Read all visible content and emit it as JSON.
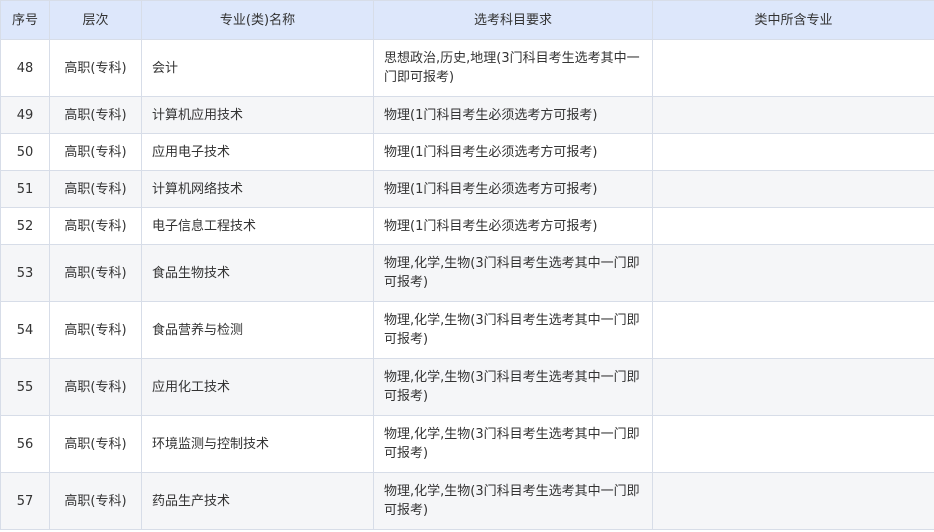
{
  "headers": {
    "seq": "序号",
    "level": "层次",
    "name": "专业(类)名称",
    "requirement": "选考科目要求",
    "sub_majors": "类中所含专业"
  },
  "rows": [
    {
      "seq": "48",
      "level": "高职(专科)",
      "name": "会计",
      "requirement": "思想政治,历史,地理(3门科目考生选考其中一门即可报考)",
      "sub_majors": ""
    },
    {
      "seq": "49",
      "level": "高职(专科)",
      "name": "计算机应用技术",
      "requirement": "物理(1门科目考生必须选考方可报考)",
      "sub_majors": ""
    },
    {
      "seq": "50",
      "level": "高职(专科)",
      "name": "应用电子技术",
      "requirement": "物理(1门科目考生必须选考方可报考)",
      "sub_majors": ""
    },
    {
      "seq": "51",
      "level": "高职(专科)",
      "name": "计算机网络技术",
      "requirement": "物理(1门科目考生必须选考方可报考)",
      "sub_majors": ""
    },
    {
      "seq": "52",
      "level": "高职(专科)",
      "name": "电子信息工程技术",
      "requirement": "物理(1门科目考生必须选考方可报考)",
      "sub_majors": ""
    },
    {
      "seq": "53",
      "level": "高职(专科)",
      "name": "食品生物技术",
      "requirement": "物理,化学,生物(3门科目考生选考其中一门即可报考)",
      "sub_majors": ""
    },
    {
      "seq": "54",
      "level": "高职(专科)",
      "name": "食品营养与检测",
      "requirement": "物理,化学,生物(3门科目考生选考其中一门即可报考)",
      "sub_majors": ""
    },
    {
      "seq": "55",
      "level": "高职(专科)",
      "name": "应用化工技术",
      "requirement": "物理,化学,生物(3门科目考生选考其中一门即可报考)",
      "sub_majors": ""
    },
    {
      "seq": "56",
      "level": "高职(专科)",
      "name": "环境监测与控制技术",
      "requirement": "物理,化学,生物(3门科目考生选考其中一门即可报考)",
      "sub_majors": ""
    },
    {
      "seq": "57",
      "level": "高职(专科)",
      "name": "药品生产技术",
      "requirement": "物理,化学,生物(3门科目考生选考其中一门即可报考)",
      "sub_majors": ""
    }
  ]
}
